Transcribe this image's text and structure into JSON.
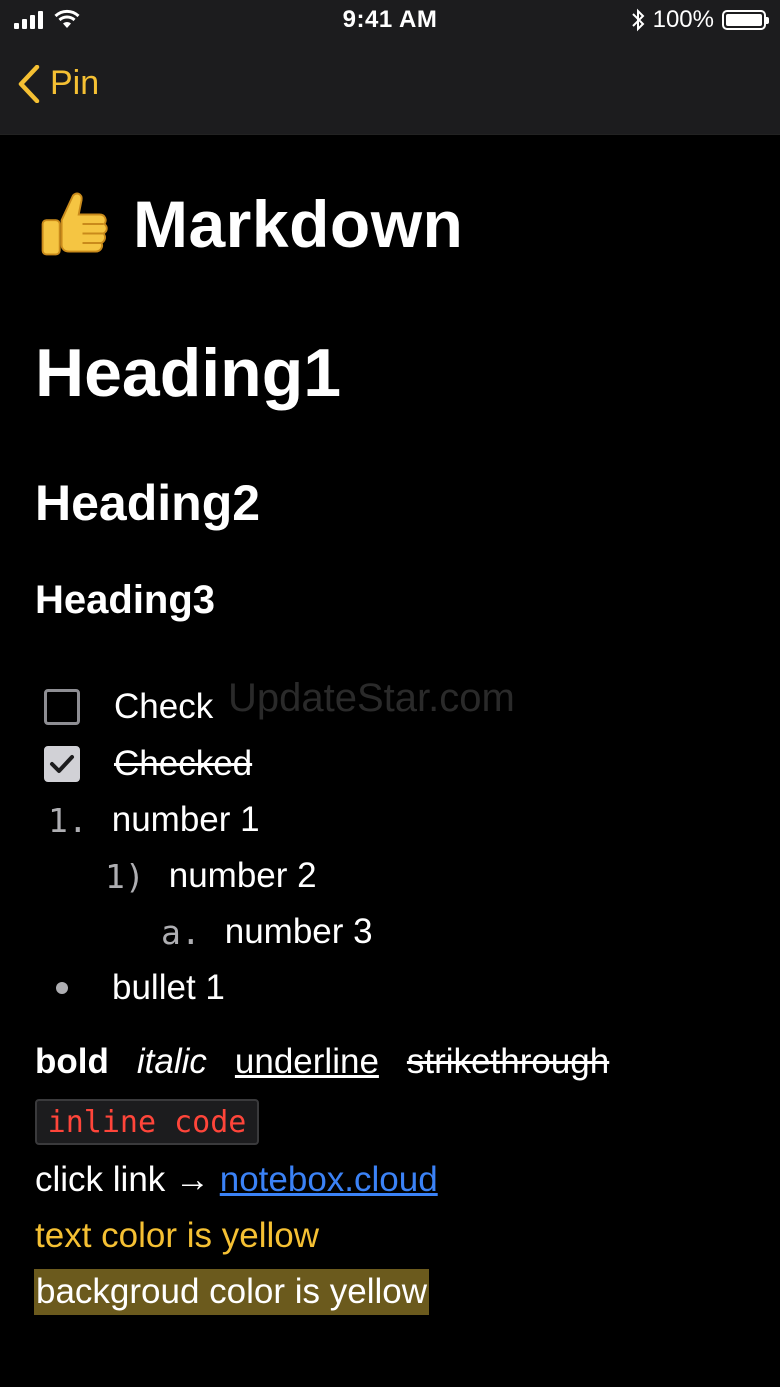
{
  "status_bar": {
    "time": "9:41 AM",
    "battery_text": "100%",
    "battery_level": 1.0
  },
  "nav": {
    "back_label": "Pin",
    "accent_color": "#f5c033"
  },
  "note": {
    "title": "Markdown",
    "title_icon": "thumbs-up-icon",
    "heading1": "Heading1",
    "heading2": "Heading2",
    "heading3": "Heading3",
    "watermark": "UpdateStar.com",
    "check_item": "Check",
    "checked_item": "Checked",
    "numbered": [
      {
        "marker": "1.",
        "text": "number 1"
      },
      {
        "marker": "1)",
        "text": "number 2"
      },
      {
        "marker": "a.",
        "text": "number 3"
      }
    ],
    "bullet": "bullet 1",
    "bold": "bold",
    "italic": "italic",
    "underline": "underline",
    "strikethrough": "strikethrough",
    "inline_code": "inline code",
    "link_prefix": "click link → ",
    "link_text": "notebox.cloud",
    "yellow_text": "text color is yellow",
    "yellow_background": "backgroud color is yellow"
  }
}
